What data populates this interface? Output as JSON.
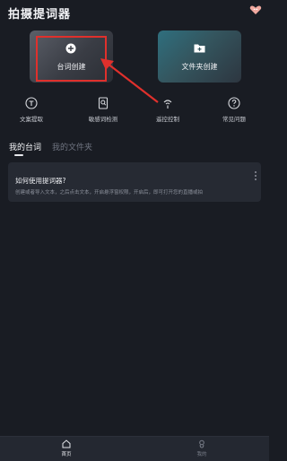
{
  "app": {
    "title": "拍摄提词器"
  },
  "header": {
    "vip_icon": "heart-crown-icon"
  },
  "cards": {
    "script": {
      "label": "台词创建",
      "icon": "plus-circle-icon"
    },
    "folder": {
      "label": "文件夹创建",
      "icon": "folder-plus-icon"
    }
  },
  "features": [
    {
      "label": "文案提取",
      "icon": "text-extract-icon"
    },
    {
      "label": "敏感词检测",
      "icon": "document-scan-icon"
    },
    {
      "label": "遥控控制",
      "icon": "remote-signal-icon"
    },
    {
      "label": "常见问题",
      "icon": "question-circle-icon"
    }
  ],
  "tabs": [
    {
      "label": "我的台词",
      "active": true
    },
    {
      "label": "我的文件夹",
      "active": false
    }
  ],
  "guide": {
    "title": "如何使用提词器?",
    "description": "创建或者导入文本，之后点击文本，开启悬浮窗权限，开启后，即可打开您的直播或拍"
  },
  "bottom_nav": [
    {
      "label": "首页",
      "icon": "home-icon",
      "active": true
    },
    {
      "label": "我的",
      "icon": "user-icon",
      "active": false
    }
  ],
  "colors": {
    "background": "#191c23",
    "highlight": "#e0302c",
    "card_bg": "#262a33"
  }
}
